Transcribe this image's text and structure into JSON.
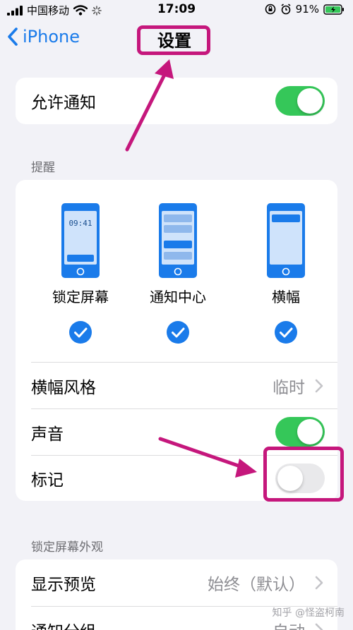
{
  "status_bar": {
    "carrier": "中国移动",
    "time": "17:09",
    "battery": "91%"
  },
  "nav": {
    "back_label": "iPhone",
    "title": "设置"
  },
  "allow_notifications": {
    "label": "允许通知",
    "enabled": true
  },
  "alerts": {
    "header": "提醒",
    "styles": [
      {
        "label": "锁定屏幕",
        "checked": true,
        "clock": "09:41"
      },
      {
        "label": "通知中心",
        "checked": true
      },
      {
        "label": "横幅",
        "checked": true
      }
    ],
    "banner_style": {
      "label": "横幅风格",
      "value": "临时"
    },
    "sounds": {
      "label": "声音",
      "enabled": true
    },
    "badges": {
      "label": "标记",
      "enabled": false
    }
  },
  "lock_screen_appearance": {
    "header": "锁定屏幕外观",
    "show_previews": {
      "label": "显示预览",
      "value": "始终（默认）"
    },
    "notification_grouping": {
      "label": "通知分组",
      "value": "自动"
    }
  },
  "watermark": "知乎 @怪盗柯南",
  "colors": {
    "accent_blue": "#1a7bea",
    "toggle_on": "#35c759",
    "toggle_off": "#e9e9eb",
    "annotation": "#c5177c",
    "background": "#f2f2f7"
  }
}
